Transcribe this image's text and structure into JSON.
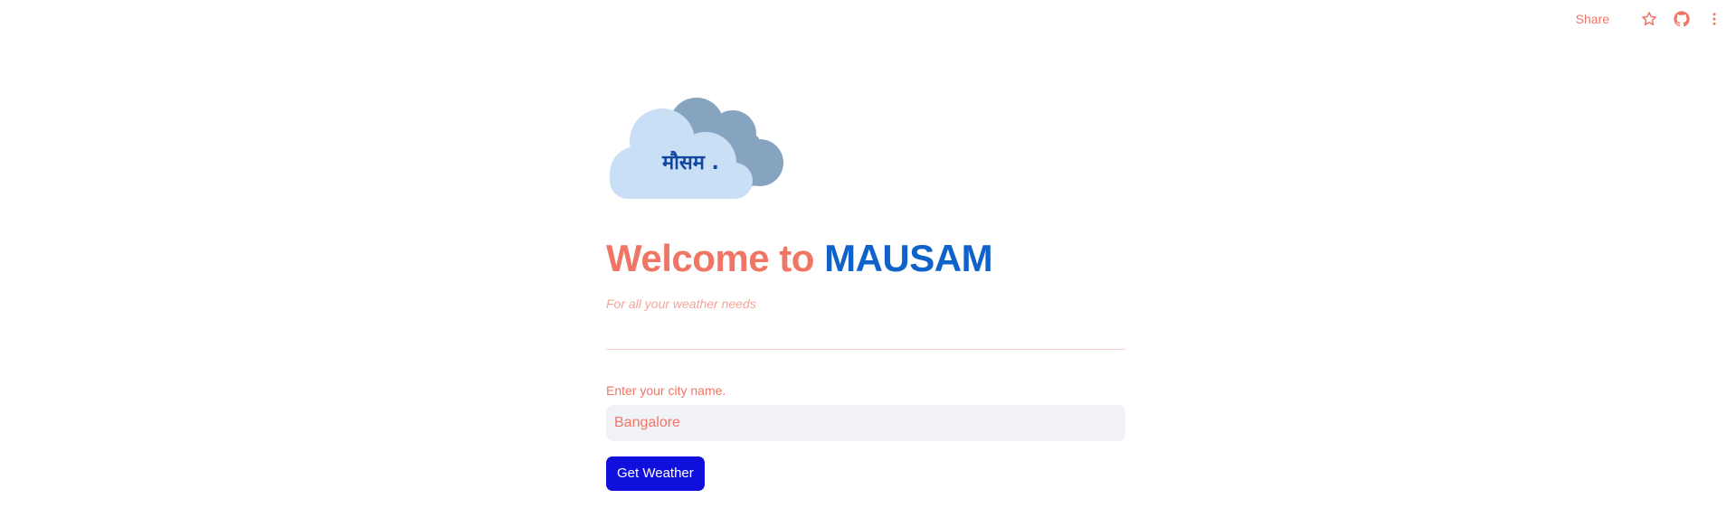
{
  "toolbar": {
    "share_label": "Share",
    "icons": [
      "star-icon",
      "github-icon",
      "more-vertical-icon"
    ]
  },
  "logo": {
    "text": "मौसम .",
    "colors": {
      "front_cloud": "#c8dff6",
      "back_cloud": "#86a3bf",
      "text": "#1147a0"
    }
  },
  "header": {
    "title_part1": "Welcome to ",
    "title_part2": "MAUSAM",
    "subtitle": "For all your weather needs"
  },
  "form": {
    "city_label": "Enter your city name.",
    "city_value": "Bangalore",
    "submit_label": "Get Weather"
  },
  "colors": {
    "accent": "#f07565",
    "brand_blue": "#0f62c9",
    "button": "#1010dd"
  }
}
